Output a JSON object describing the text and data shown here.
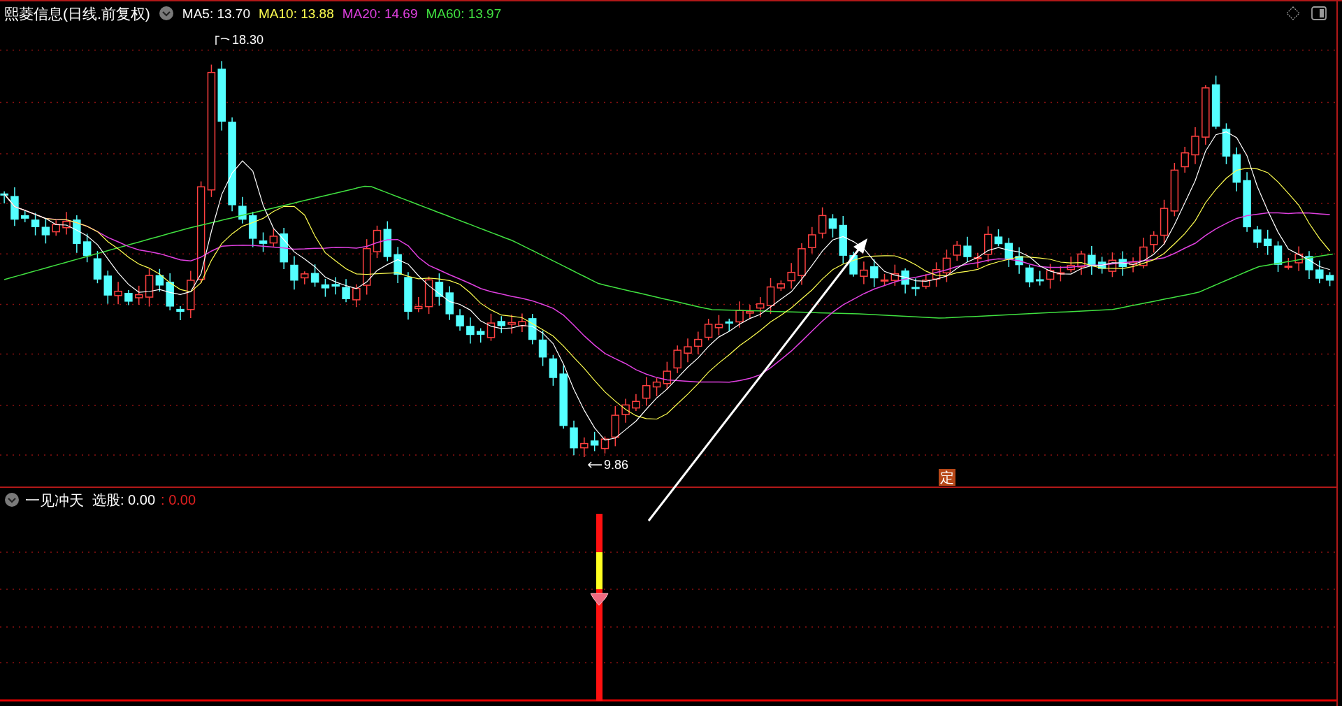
{
  "title": "熙菱信息(日线.前复权)",
  "indicators": [
    {
      "label": "MA5: 13.70",
      "color": "#ffffff"
    },
    {
      "label": "MA10: 13.88",
      "color": "#ffff50"
    },
    {
      "label": "MA20: 14.69",
      "color": "#e040e0"
    },
    {
      "label": "MA60: 13.97",
      "color": "#40e040"
    }
  ],
  "price_marks": [
    {
      "kind": "high",
      "label": "18.30"
    },
    {
      "kind": "low",
      "label": "9.86"
    }
  ],
  "badge": "定",
  "sub_panel": {
    "name": "一见冲天",
    "fields": [
      {
        "label": "选股: 0.00",
        "color": "#ffffff"
      },
      {
        "label": ": 0.00",
        "color": "#e02020"
      }
    ]
  }
}
